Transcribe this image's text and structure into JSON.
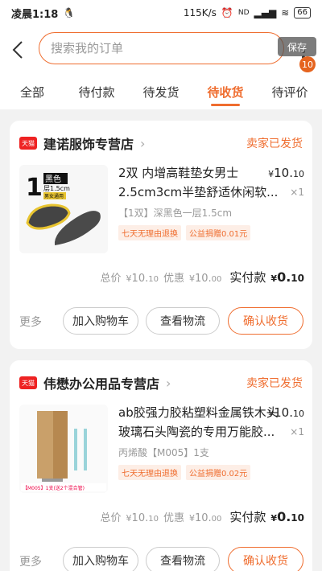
{
  "status_bar": {
    "time": "凌晨1:18",
    "speed": "115K/s",
    "battery": "66"
  },
  "header": {
    "search_placeholder": "搜索我的订单",
    "save_label": "保存",
    "badge_count": "10"
  },
  "tabs": [
    {
      "label": "全部",
      "active": false
    },
    {
      "label": "待付款",
      "active": false
    },
    {
      "label": "待发货",
      "active": false
    },
    {
      "label": "待收货",
      "active": true
    },
    {
      "label": "待评价",
      "active": false
    }
  ],
  "orders": [
    {
      "shop_badge": "天猫",
      "shop_name": "建诺服饰专营店",
      "status": "卖家已发货",
      "product_title": "2双 内增高鞋垫女男士2.5cm3cm半垫舒适休闲软...",
      "price_yen": "¥",
      "price_int": "10.",
      "price_dec": "10",
      "qty": "×1",
      "sku": "【1双】深黑色一层1.5cm",
      "image_caption_num": "1",
      "image_caption_text": "黑色",
      "image_caption_sub": "层1.5cm",
      "image_caption_tag": "男女通用",
      "tags": [
        "七天无理由退换",
        "公益捐赠0.01元"
      ],
      "total_label": "总价",
      "total_yen": "¥",
      "total_int": "10.",
      "total_dec": "10",
      "discount_label": "优惠",
      "discount_yen": "¥",
      "discount_int": "10.",
      "discount_dec": "00",
      "actual_label": "实付款",
      "actual_yen": "¥",
      "actual_int": "0.",
      "actual_dec": "10",
      "more": "更多",
      "btn_cart": "加入购物车",
      "btn_logistics": "查看物流",
      "btn_confirm": "确认收货"
    },
    {
      "shop_badge": "天猫",
      "shop_name": "伟懋办公用品专营店",
      "status": "卖家已发货",
      "product_title": "ab胶强力胶粘塑料金属铁木头玻璃石头陶瓷的专用万能胶...",
      "price_yen": "¥",
      "price_int": "10.",
      "price_dec": "10",
      "qty": "×1",
      "sku": "丙烯酸【M005】1支",
      "image_caption_text": "【M005】1支(送2个混合管)",
      "tags": [
        "七天无理由退换",
        "公益捐赠0.02元"
      ],
      "total_label": "总价",
      "total_yen": "¥",
      "total_int": "10.",
      "total_dec": "10",
      "discount_label": "优惠",
      "discount_yen": "¥",
      "discount_int": "10.",
      "discount_dec": "00",
      "actual_label": "实付款",
      "actual_yen": "¥",
      "actual_int": "0.",
      "actual_dec": "10",
      "more": "更多",
      "btn_cart": "加入购物车",
      "btn_logistics": "查看物流",
      "btn_confirm": "确认收货"
    }
  ],
  "colors": {
    "accent": "#ef6d2f",
    "tmall_red": "#e22222",
    "tag_bg": "#fdeee6"
  }
}
